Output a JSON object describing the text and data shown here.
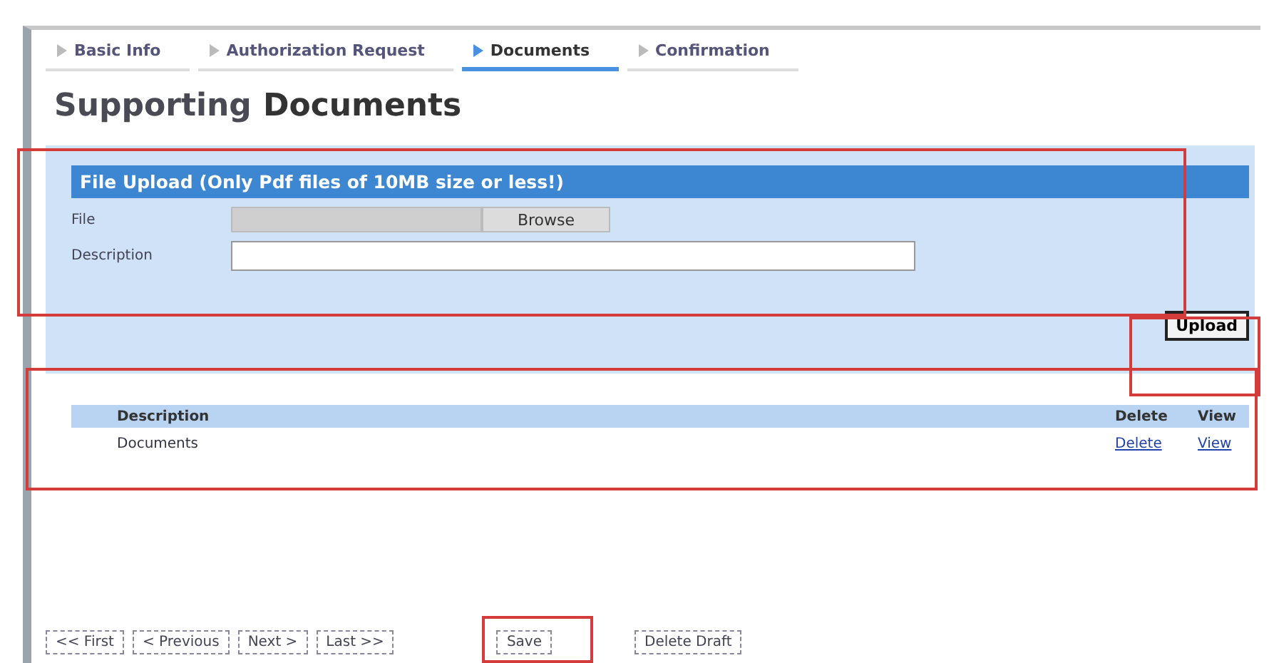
{
  "tabs": [
    {
      "label": "Basic Info",
      "selected": false
    },
    {
      "label": "Authorization Request",
      "selected": false
    },
    {
      "label": "Documents",
      "selected": true
    },
    {
      "label": "Confirmation",
      "selected": false
    }
  ],
  "title": {
    "first": "Supporting",
    "second": "Documents"
  },
  "upload": {
    "header": "File Upload (Only Pdf files of 10MB size or less!)",
    "file_label": "File",
    "browse": "Browse",
    "description_label": "Description",
    "upload_button": "Upload"
  },
  "table": {
    "columns": [
      "Description",
      "Delete",
      "View"
    ],
    "rows": [
      {
        "description": "Documents",
        "delete": "Delete",
        "view": "View"
      }
    ]
  },
  "footer_buttons": [
    {
      "label": "<< First",
      "kind": "nav"
    },
    {
      "label": "< Previous",
      "kind": "nav"
    },
    {
      "label": "Next >",
      "kind": "nav"
    },
    {
      "label": "Last >>",
      "kind": "nav"
    },
    {
      "label": "Save",
      "kind": "action"
    },
    {
      "label": "Delete Draft",
      "kind": "action"
    }
  ]
}
